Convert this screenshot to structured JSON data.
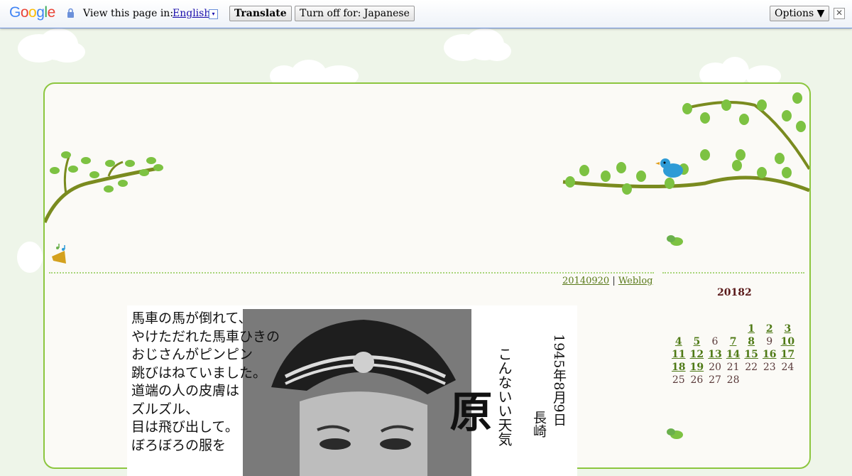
{
  "translate_bar": {
    "logo": "Google",
    "view_text": "View this page in:",
    "language": "English",
    "dropdown_glyph": "▾",
    "translate_label": "Translate",
    "turn_off_label": "Turn off for: Japanese",
    "options_label": "Options ▼",
    "close_glyph": "✕"
  },
  "post": {
    "date": "20140920",
    "separator": "|",
    "category": "Weblog"
  },
  "photo": {
    "poem": "馬車の馬が倒れて、\nやけただれた馬車ひきの\nおじさんがピンピン\n跳びはねていました。\n道端の人の皮膚は\nズルズル、\n目は飛び出して。\nぼろぼろの服を",
    "date_vertical": "1945年8月9日",
    "caption_vertical": "こんないい天気",
    "name_vertical": "原",
    "place_vertical": "長崎"
  },
  "calendar": {
    "title": "20182",
    "rows": [
      [
        "",
        "",
        "",
        "",
        "1",
        "2",
        "3"
      ],
      [
        "4",
        "5",
        "6",
        "7",
        "8",
        "9",
        "10"
      ],
      [
        "11",
        "12",
        "13",
        "14",
        "15",
        "16",
        "17"
      ],
      [
        "18",
        "19",
        "20",
        "21",
        "22",
        "23",
        "24"
      ],
      [
        "25",
        "26",
        "27",
        "28",
        "",
        "",
        ""
      ]
    ],
    "linked_days": [
      "1",
      "2",
      "3",
      "4",
      "5",
      "7",
      "8",
      "10",
      "11",
      "12",
      "13",
      "14",
      "15",
      "16",
      "17",
      "18",
      "19"
    ]
  },
  "colors": {
    "accent_green": "#8cc63f",
    "link_green": "#4f7a16",
    "page_bg": "#eef5e9"
  }
}
